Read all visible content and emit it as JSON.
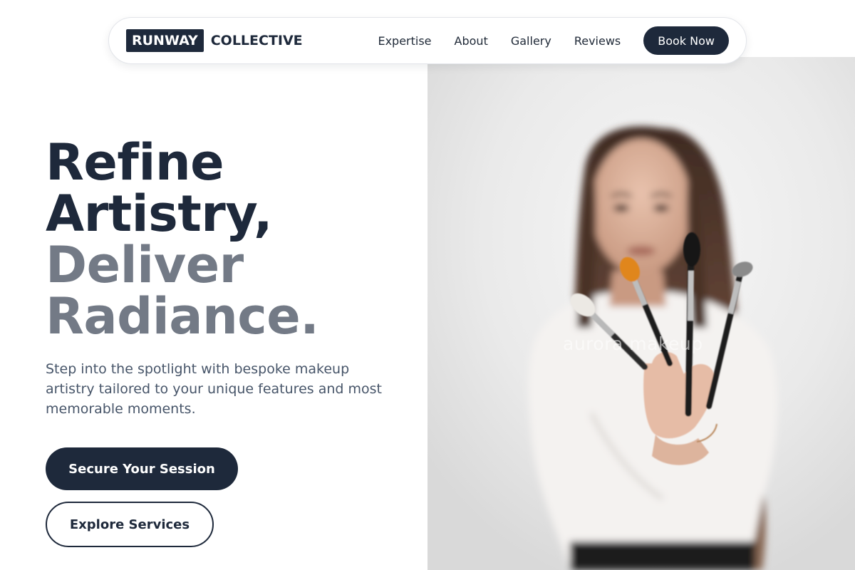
{
  "brand": {
    "logo_box": "RUNWAY",
    "logo_text": "COLLECTIVE"
  },
  "nav": {
    "links": [
      "Expertise",
      "About",
      "Gallery",
      "Reviews"
    ],
    "cta": "Book Now"
  },
  "hero": {
    "headline_dark": [
      "Refine",
      "Artistry,"
    ],
    "headline_muted": [
      "Deliver",
      "Radiance."
    ],
    "subtext": "Step into the spotlight with bespoke makeup artistry tailored to your unique features and most memorable moments.",
    "primary_button": "Secure Your Session",
    "secondary_button": "Explore Services",
    "image_watermark": "aurora makeup"
  },
  "colors": {
    "primary": "#1e293b",
    "muted_headline": "#737a86",
    "body_text": "#475569",
    "background": "#ffffff"
  }
}
